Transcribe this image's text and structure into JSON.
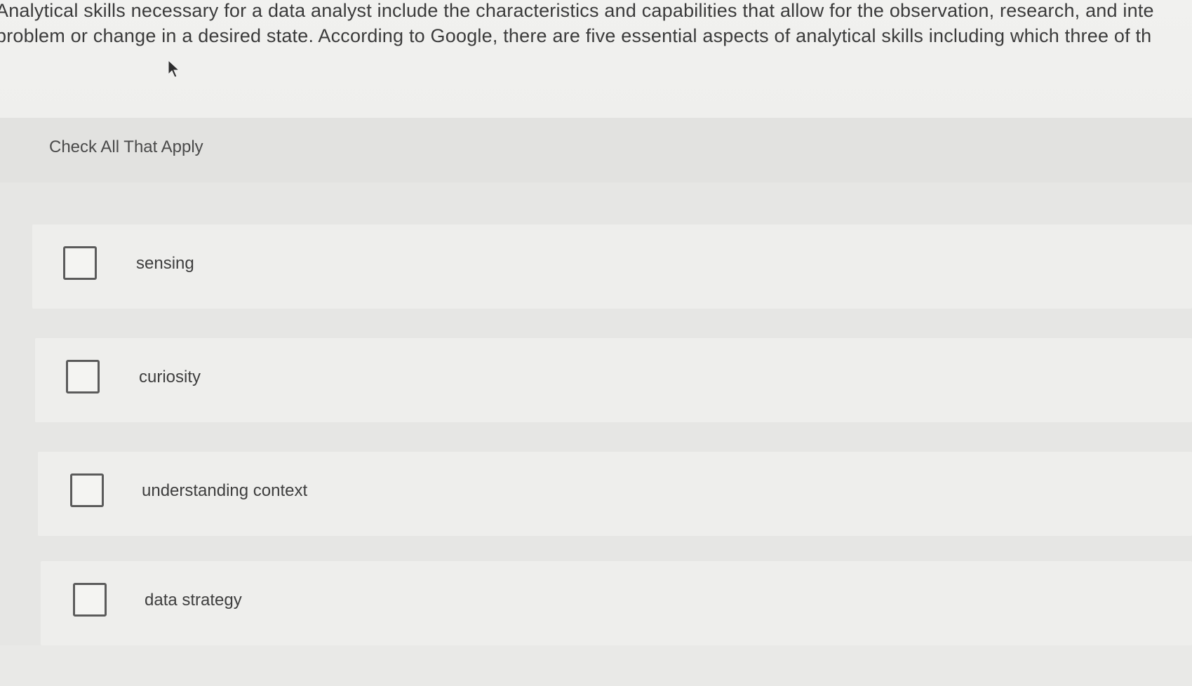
{
  "question": {
    "line1": "Analytical skills necessary for a data analyst include the characteristics and capabilities that allow for the observation, research, and inte",
    "line2": "problem or change in a desired state. According to Google, there are five essential aspects of analytical skills including which three of th"
  },
  "instruction": "Check All That Apply",
  "options": [
    {
      "label": "sensing",
      "checked": false
    },
    {
      "label": "curiosity",
      "checked": false
    },
    {
      "label": "understanding context",
      "checked": false
    },
    {
      "label": "data strategy",
      "checked": false
    }
  ],
  "icons": {
    "cursor": "mouse-pointer-icon",
    "checkbox": "checkbox-unchecked-icon"
  },
  "colors": {
    "background": "#e8e8e6",
    "text": "#3b3b3b",
    "checkbox_border": "#5b5b5b"
  }
}
